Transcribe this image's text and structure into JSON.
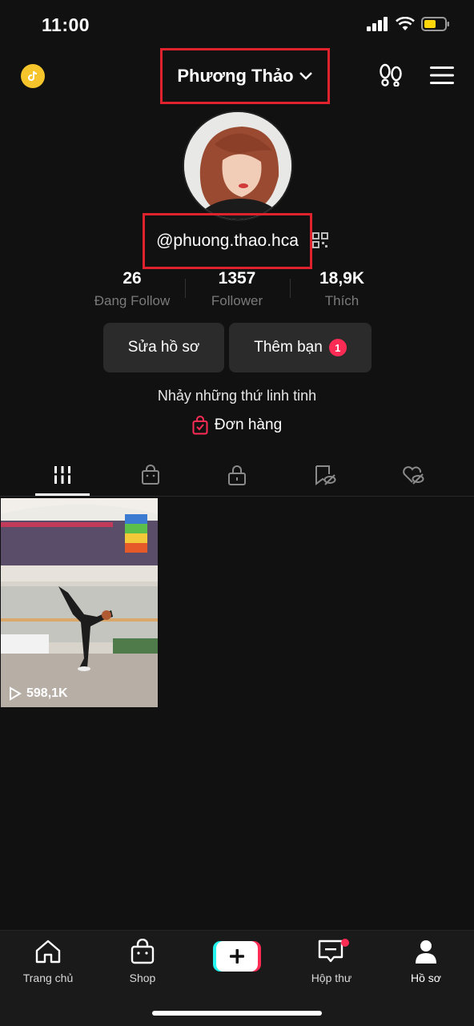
{
  "status": {
    "time": "11:00"
  },
  "header": {
    "display_name": "Phương Thảo",
    "coin_icon": "coin-icon"
  },
  "profile": {
    "handle": "@phuong.thao.hca",
    "bio": "Nhảy những thứ linh tinh",
    "orders_label": "Đơn hàng"
  },
  "stats": [
    {
      "value": "26",
      "label": "Đang Follow"
    },
    {
      "value": "1357",
      "label": "Follower"
    },
    {
      "value": "18,9K",
      "label": "Thích"
    }
  ],
  "buttons": {
    "edit_profile": "Sửa hồ sơ",
    "add_friends": "Thêm bạn",
    "add_friends_badge": "1"
  },
  "tabs": [
    "videos-grid-icon",
    "shop-bag-icon",
    "lock-icon",
    "bookmark-hidden-icon",
    "liked-hidden-icon"
  ],
  "videos": [
    {
      "views": "598,1K"
    }
  ],
  "nav": [
    {
      "label": "Trang chủ"
    },
    {
      "label": "Shop"
    },
    {
      "label": ""
    },
    {
      "label": "Hộp thư"
    },
    {
      "label": "Hồ sơ"
    }
  ],
  "colors": {
    "accent": "#fe2c55",
    "highlight_box": "#e0222e",
    "background": "#111111"
  }
}
